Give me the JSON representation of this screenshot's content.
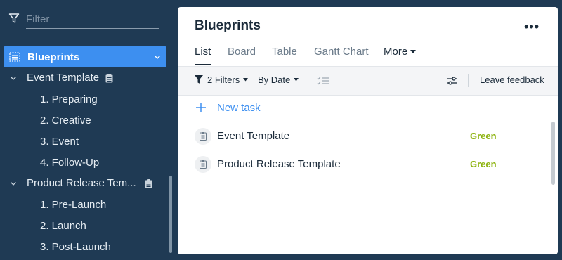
{
  "sidebar": {
    "filter_placeholder": "Filter",
    "active_item": "Blueprints",
    "tree": [
      {
        "label": "Event Template",
        "children": [
          "1. Preparing",
          "2. Creative",
          "3. Event",
          "4. Follow-Up"
        ]
      },
      {
        "label": "Product Release Tem...",
        "children": [
          "1. Pre-Launch",
          "2. Launch",
          "3. Post-Launch"
        ]
      }
    ]
  },
  "panel": {
    "title": "Blueprints",
    "menu_label": "•••",
    "tabs": [
      "List",
      "Board",
      "Table",
      "Gantt Chart",
      "More"
    ],
    "active_tab": "List",
    "toolbar": {
      "filters_label": "2 Filters",
      "sort_label": "By Date",
      "feedback_label": "Leave feedback"
    },
    "new_task_label": "New task",
    "rows": [
      {
        "name": "Event Template",
        "status": "Green"
      },
      {
        "name": "Product Release Template",
        "status": "Green"
      }
    ]
  },
  "colors": {
    "sidebar_bg": "#1f3a54",
    "accent": "#3d8ff0",
    "status_green": "#8db30f"
  }
}
